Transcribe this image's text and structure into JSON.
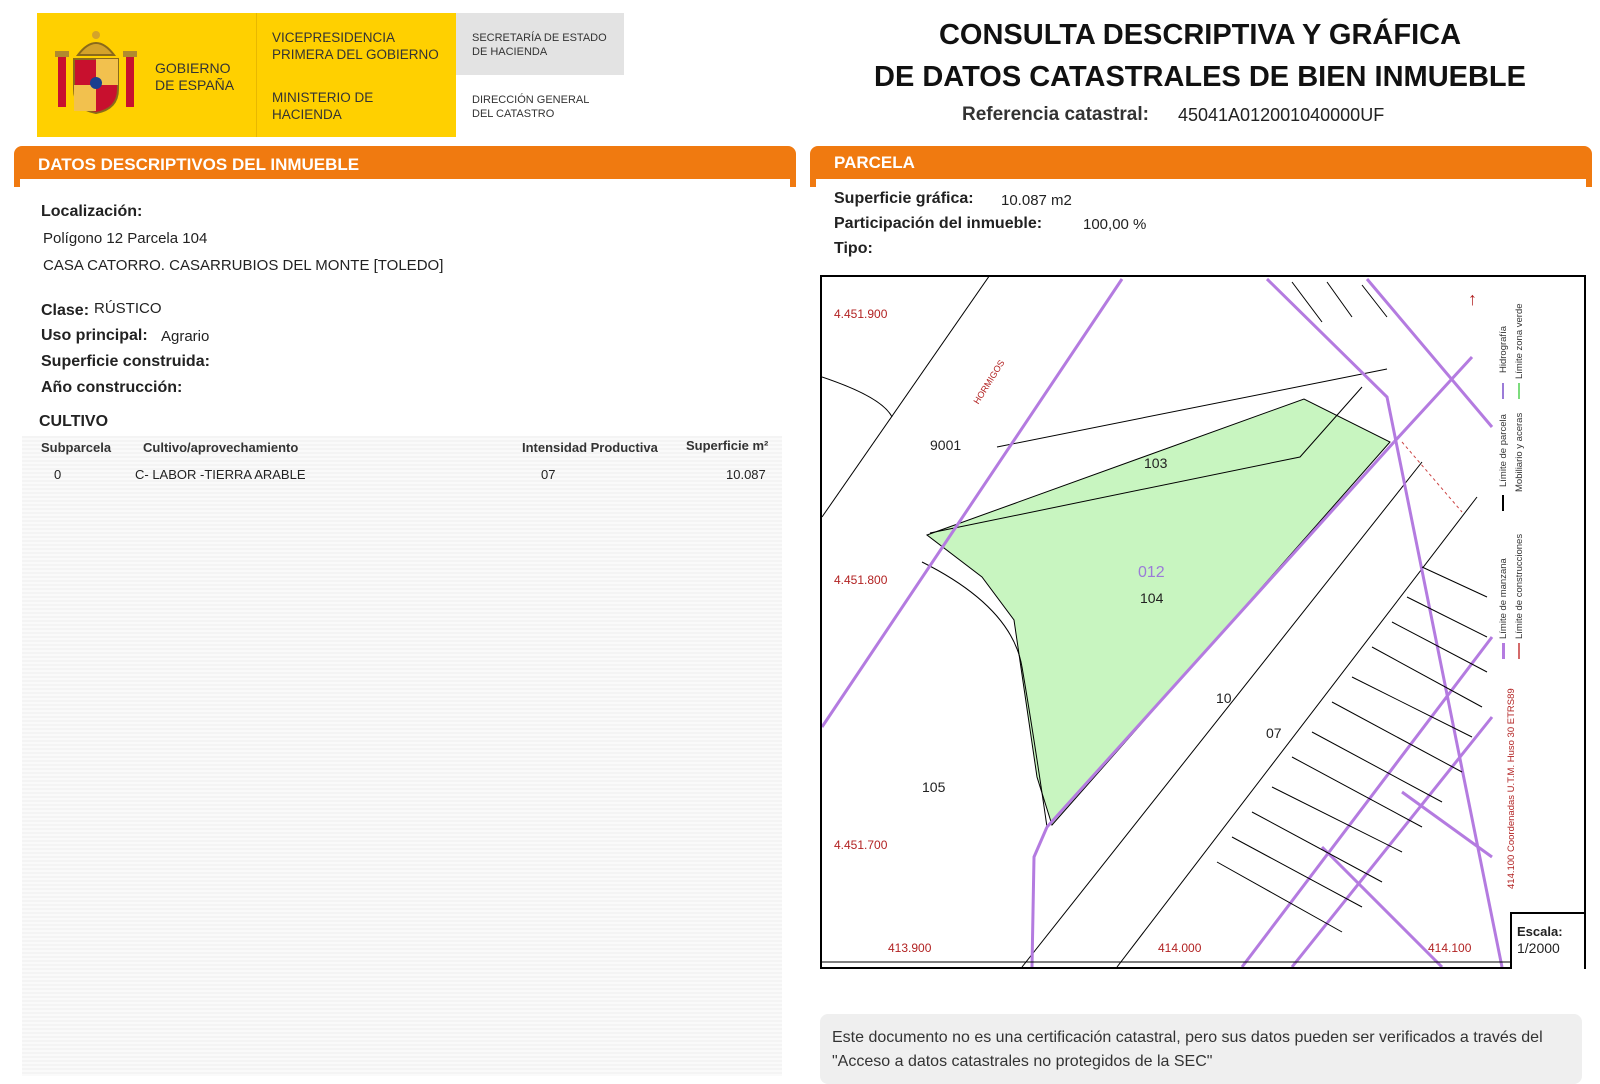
{
  "header": {
    "gobierno": "GOBIERNO DE ESPAÑA",
    "vicepresidencia": "VICEPRESIDENCIA PRIMERA DEL GOBIERNO",
    "ministerio": "MINISTERIO DE HACIENDA",
    "secretaria": "SECRETARÍA DE ESTADO DE HACIENDA",
    "direccion": "DIRECCIÓN GENERAL DEL CATASTRO",
    "title_line1": "CONSULTA DESCRIPTIVA Y GRÁFICA",
    "title_line2": "DE DATOS CATASTRALES DE BIEN INMUEBLE",
    "ref_label": "Referencia catastral:",
    "ref_value": "45041A012001040000UF"
  },
  "left": {
    "bar_title": "DATOS DESCRIPTIVOS DEL INMUEBLE",
    "localizacion_label": "Localización:",
    "localizacion_line1": "Polígono 12 Parcela 104",
    "localizacion_line2": "CASA CATORRO. CASARRUBIOS DEL MONTE [TOLEDO]",
    "clase_label": "Clase:",
    "clase_value": "RÚSTICO",
    "uso_label": "Uso principal:",
    "uso_value": "Agrario",
    "superficie_label": "Superficie construida:",
    "anio_label": "Año construcción:",
    "cultivo_title": "CULTIVO",
    "cultivo_headers": [
      "Subparcela",
      "Cultivo/aprovechamiento",
      "Intensidad Productiva",
      "Superficie m²"
    ],
    "cultivo_rows": [
      [
        "0",
        "C- LABOR -TIERRA ARABLE",
        "07",
        "10.087"
      ]
    ]
  },
  "right": {
    "bar_title": "PARCELA",
    "superficie_label": "Superficie gráfica:",
    "superficie_value": "10.087 m2",
    "participacion_label": "Participación del inmueble:",
    "participacion_value": "100,00 %",
    "tipo_label": "Tipo:"
  },
  "map": {
    "y_ticks": [
      "4.451.900",
      "4.451.800",
      "4.451.700"
    ],
    "x_ticks": [
      "413.900",
      "414.000",
      "414.100"
    ],
    "parcel_labels": [
      "9001",
      "103",
      "012",
      "104",
      "10",
      "07",
      "105"
    ],
    "street_label": "HORMIGOS",
    "scale_label": "Escala:",
    "scale_value": "1/2000",
    "legend": [
      "Límite zona verde",
      "Hidrografía",
      "Mobiliario y aceras",
      "Límite de parcela",
      "Límite de construcciones",
      "Límite de manzana"
    ],
    "coords_note": "414.100 Coordenadas U.T.M. Huso 30 ETRS89",
    "colors": {
      "parcel_fill": "#c8f5c0",
      "block_line": "#b47be0",
      "coord_text": "#b22222"
    }
  },
  "note": {
    "text": "Este documento no es una certificación catastral, pero sus datos pueden ser verificados a través del \"Acceso a datos catastrales no protegidos de la SEC\""
  }
}
